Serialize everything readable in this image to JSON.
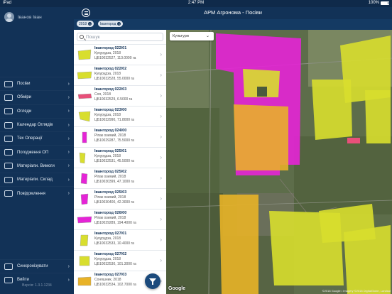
{
  "statusbar": {
    "left": "iPad",
    "time": "2:47 PM",
    "battery": "100%"
  },
  "user": {
    "name": "Іванов Іван"
  },
  "header": {
    "title": "АРМ Агронома - Посіви"
  },
  "chips": [
    {
      "label": "2018"
    },
    {
      "label": "Івангород"
    }
  ],
  "search": {
    "placeholder": "Пошук"
  },
  "map": {
    "dropdown": "Культури",
    "google": "Google",
    "attribution": "©2018 Google • Imagery ©2018 DigitalGlobe, Landsat"
  },
  "menu": [
    {
      "label": "Посіви",
      "icon": "sprout-icon"
    },
    {
      "label": "Обміри",
      "icon": "ruler-icon"
    },
    {
      "label": "Огляди",
      "icon": "binoculars-icon"
    },
    {
      "label": "Календар Оглядів",
      "icon": "calendar-icon"
    },
    {
      "label": "Тех Операції",
      "icon": "tractor-icon"
    },
    {
      "label": "Погодження ОП",
      "icon": "document-icon"
    },
    {
      "label": "Матеріали. Вимоги",
      "icon": "clipboard-icon"
    },
    {
      "label": "Матеріали. Склад",
      "icon": "warehouse-icon"
    },
    {
      "label": "Повідомлення",
      "icon": "megaphone-icon"
    }
  ],
  "menu_bottom": [
    {
      "label": "Синхронізувати",
      "icon": "sync-icon"
    },
    {
      "label": "Вийти",
      "icon": "logout-icon"
    }
  ],
  "version": "Версія: 1.3.1.1234",
  "colors": {
    "corn": "#d8de2e",
    "rapeseed": "#e524d6",
    "soy": "#e8507a",
    "sunflower": "#e8b227",
    "sidebar": "#123257"
  },
  "fields": [
    {
      "name": "Івангород 022/01",
      "crop": "Кукурудза, 2018",
      "cad": "ЦБ10032527, 113.0000 га",
      "color": "corn"
    },
    {
      "name": "Івангород 022/02",
      "crop": "Кукурудза, 2018",
      "cad": "ЦБ10032528, 55.0000 га",
      "color": "corn"
    },
    {
      "name": "Івангород 022/03",
      "crop": "Соя, 2018",
      "cad": "ЦБ10032529, 6.5000 га",
      "color": "soy"
    },
    {
      "name": "Івангород 023/00",
      "crop": "Кукурудза, 2018",
      "cad": "ЦБ10032990, 71.8000 га",
      "color": "corn"
    },
    {
      "name": "Івангород 024/00",
      "crop": "Ріпак озимий, 2018",
      "cad": "ЦБ10029287, 75.5000 га",
      "color": "rapeseed"
    },
    {
      "name": "Івангород 025/01",
      "crop": "Кукурудза, 2018",
      "cad": "ЦБ10032531, 45.5000 га",
      "color": "corn"
    },
    {
      "name": "Івангород 025/02",
      "crop": "Ріпак озимий, 2018",
      "cad": "ЦБ10030399, 47.1000 га",
      "color": "rapeseed"
    },
    {
      "name": "Івангород 025/03",
      "crop": "Ріпак озимий, 2018",
      "cad": "ЦБ10030400, 42.3000 га",
      "color": "rapeseed"
    },
    {
      "name": "Івангород 026/00",
      "crop": "Ріпак озимий, 2018",
      "cad": "ЦБ10029289, 194.4000 га",
      "color": "rapeseed"
    },
    {
      "name": "Івангород 027/01",
      "crop": "Кукурудза, 2018",
      "cad": "ЦБ10032533, 10.4000 га",
      "color": "corn"
    },
    {
      "name": "Івангород 027/02",
      "crop": "Кукурудза, 2018",
      "cad": "ЦБ10032530, 101.3000 га",
      "color": "corn"
    },
    {
      "name": "Івангород 027/03",
      "crop": "Соняшник, 2018",
      "cad": "ЦБ10032534, 102.7000 га",
      "color": "sunflower"
    }
  ]
}
